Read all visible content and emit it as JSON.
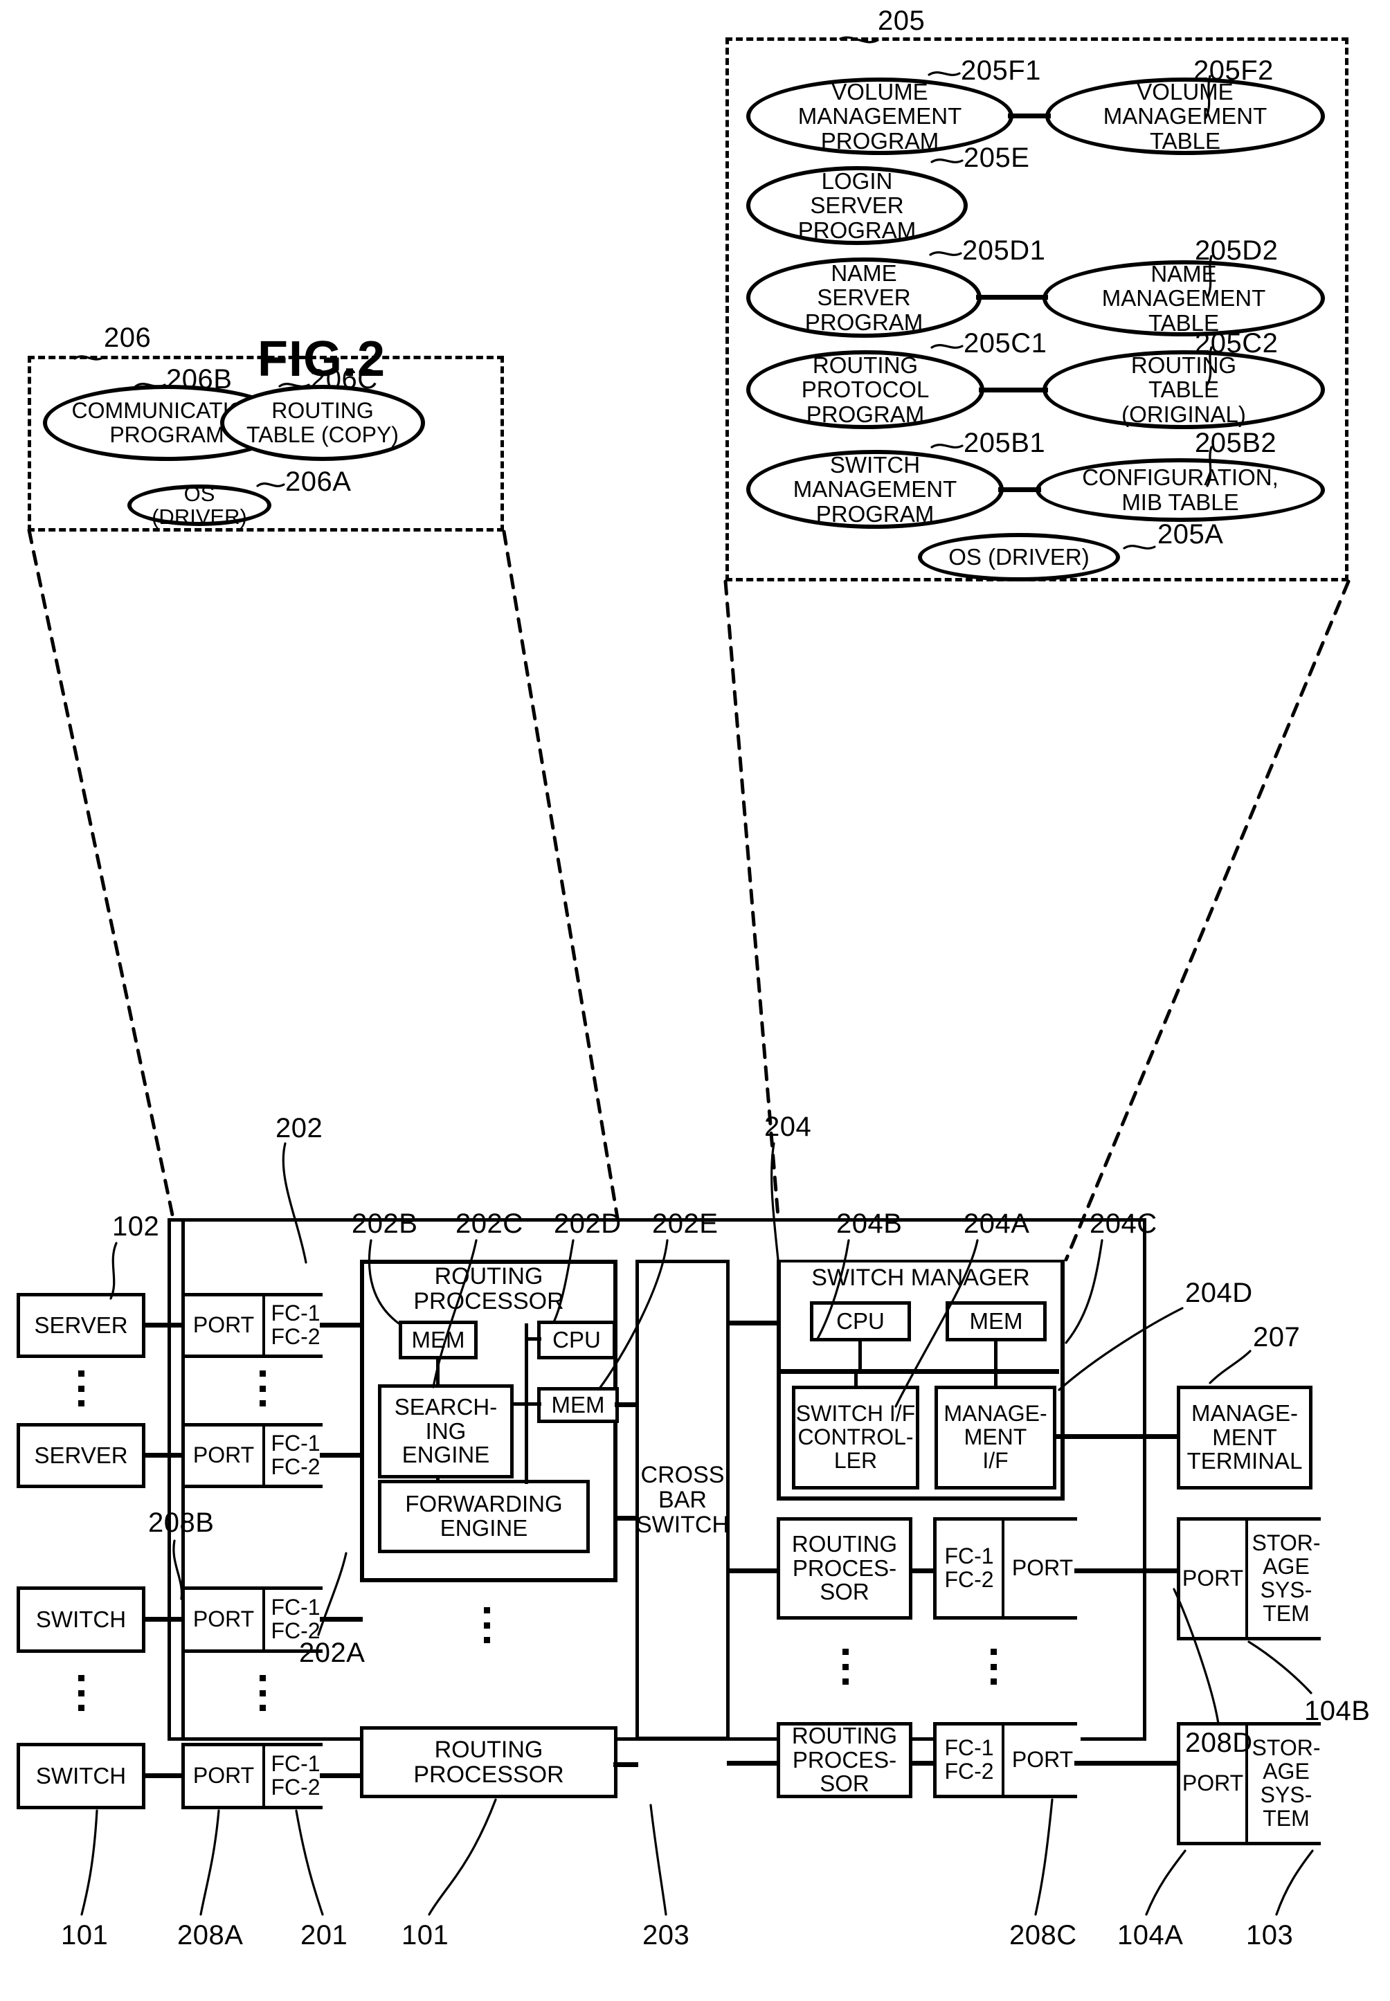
{
  "figure": {
    "title": "FIG.2"
  },
  "memory_205": {
    "ref": "205",
    "nodes": [
      {
        "ref": "205F1",
        "label": "VOLUME\nMANAGEMENT\nPROGRAM"
      },
      {
        "ref": "205F2",
        "label": "VOLUME\nMANAGEMENT\nTABLE"
      },
      {
        "ref": "205E",
        "label": "LOGIN\nSERVER\nPROGRAM"
      },
      {
        "ref": "205D1",
        "label": "NAME\nSERVER\nPROGRAM"
      },
      {
        "ref": "205D2",
        "label": "NAME\nMANAGEMENT\nTABLE"
      },
      {
        "ref": "205C1",
        "label": "ROUTING\nPROTOCOL\nPROGRAM"
      },
      {
        "ref": "205C2",
        "label": "ROUTING\nTABLE\n(ORIGINAL)"
      },
      {
        "ref": "205B1",
        "label": "SWITCH\nMANAGEMENT\nPROGRAM"
      },
      {
        "ref": "205B2",
        "label": "CONFIGURATION,\nMIB TABLE"
      },
      {
        "ref": "205A",
        "label": "OS (DRIVER)"
      }
    ]
  },
  "memory_206": {
    "ref": "206",
    "nodes": [
      {
        "ref": "206B",
        "label": "COMMUNICATION\nPROGRAM"
      },
      {
        "ref": "206C",
        "label": "ROUTING\nTABLE (COPY)"
      },
      {
        "ref": "206A",
        "label": "OS (DRIVER)"
      }
    ]
  },
  "diagram": {
    "left_column": [
      {
        "ref": "102",
        "label": "SERVER"
      },
      {
        "ref": "102",
        "label": "SERVER"
      },
      {
        "ref": "101",
        "label": "SWITCH"
      },
      {
        "ref": "101",
        "label": "SWITCH"
      }
    ],
    "port_column": [
      {
        "port": "PORT",
        "fc": "FC-1\nFC-2",
        "ref": "208A"
      },
      {
        "port": "PORT",
        "fc": "FC-1\nFC-2",
        "ref": "208B"
      },
      {
        "port": "PORT",
        "fc": "FC-1\nFC-2",
        "ref": ""
      },
      {
        "port": "PORT",
        "fc": "FC-1\nFC-2",
        "ref": ""
      }
    ],
    "routing_processor": {
      "ref": "202",
      "title": "ROUTING\nPROCESSOR",
      "mem_top": "MEM",
      "cpu": "CPU",
      "mem_mid": "MEM",
      "searching_engine": "SEARCH-\nING\nENGINE",
      "forwarding_engine": "FORWARDING\nENGINE",
      "refs": {
        "mem_top": "202B",
        "searching_engine": "202C",
        "cpu": "202D",
        "mem_mid": "202E",
        "forwarding_engine": "202A"
      }
    },
    "routing_processor_bottom": {
      "label": "ROUTING\nPROCESSOR",
      "ref": "101"
    },
    "crossbar": {
      "label": "CROSS\nBAR\nSWITCH",
      "ref": "203"
    },
    "switch_manager": {
      "ref": "204",
      "title": "SWITCH MANAGER",
      "cpu": "CPU",
      "mem": "MEM",
      "switch_if_controller": "SWITCH I/F\nCONTROL-\nLER",
      "management_if": "MANAGE-\nMENT\nI/F",
      "refs": {
        "cpu": "204B",
        "switch_if_controller": "204A",
        "mem": "204C",
        "management_if": "204D"
      }
    },
    "right_routing_processors": [
      {
        "label": "ROUTING\nPROCES-\nSOR"
      },
      {
        "label": "ROUTING\nPROCES-\nSOR"
      }
    ],
    "right_fc_ports": [
      {
        "fc": "FC-1\nFC-2",
        "port": "PORT",
        "ref": "208C"
      },
      {
        "fc": "FC-1\nFC-2",
        "port": "PORT",
        "ref": "208C"
      }
    ],
    "management_terminal": {
      "label": "MANAGE-\nMENT\nTERMINAL",
      "ref": "207"
    },
    "storage_systems": [
      {
        "port": "PORT",
        "label": "STOR-\nAGE\nSYS-\nTEM",
        "port_ref": "104B",
        "ref": "103"
      },
      {
        "port": "PORT",
        "label": "STOR-\nAGE\nSYS-\nTEM",
        "port_ref": "104A",
        "ref": "103"
      }
    ],
    "refs_bottom": [
      "101",
      "208A",
      "201",
      "101",
      "203",
      "208C",
      "104A",
      "103"
    ],
    "refs_misc": [
      "208D",
      "104B",
      "201"
    ]
  },
  "refs": {
    "r101": "101",
    "r102": "102",
    "r103": "103",
    "r104A": "104A",
    "r104B": "104B",
    "r201": "201",
    "r202": "202",
    "r202A": "202A",
    "r202B": "202B",
    "r202C": "202C",
    "r202D": "202D",
    "r202E": "202E",
    "r203": "203",
    "r204": "204",
    "r204A": "204A",
    "r204B": "204B",
    "r204C": "204C",
    "r204D": "204D",
    "r205": "205",
    "r205A": "205A",
    "r205B1": "205B1",
    "r205B2": "205B2",
    "r205C1": "205C1",
    "r205C2": "205C2",
    "r205D1": "205D1",
    "r205D2": "205D2",
    "r205E": "205E",
    "r205F1": "205F1",
    "r205F2": "205F2",
    "r206": "206",
    "r206A": "206A",
    "r206B": "206B",
    "r206C": "206C",
    "r207": "207",
    "r208A": "208A",
    "r208B": "208B",
    "r208C": "208C",
    "r208D": "208D"
  },
  "labels": {
    "server": "SERVER",
    "switch": "SWITCH",
    "port": "PORT",
    "fc": "FC-1\nFC-2",
    "mem": "MEM",
    "cpu": "CPU",
    "routing_processor": "ROUTING\nPROCESSOR",
    "routing_proces_sor": "ROUTING\nPROCES-\nSOR",
    "searching_engine": "SEARCH-\nING\nENGINE",
    "forwarding_engine": "FORWARDING\nENGINE",
    "crossbar": "CROSS\nBAR\nSWITCH",
    "switch_manager": "SWITCH MANAGER",
    "switch_if_controller": "SWITCH I/F\nCONTROL-\nLER",
    "management_if": "MANAGE-\nMENT\nI/F",
    "management_terminal": "MANAGE-\nMENT\nTERMINAL",
    "storage_system": "STOR-\nAGE\nSYS-\nTEM"
  }
}
